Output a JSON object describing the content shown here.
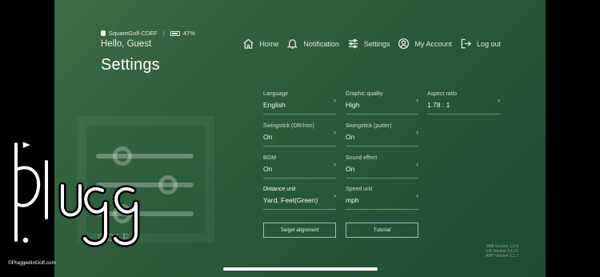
{
  "status": {
    "device": "SquareGolf-CDEF",
    "separator": "|",
    "battery": "47%"
  },
  "greeting": "Hello, Guest",
  "title": "Settings",
  "nav": [
    {
      "label": "Home",
      "icon": "home-icon"
    },
    {
      "label": "Notification",
      "icon": "bell-icon"
    },
    {
      "label": "Settings",
      "icon": "sliders-icon"
    },
    {
      "label": "My Account",
      "icon": "user-icon"
    },
    {
      "label": "Log out",
      "icon": "logout-icon"
    }
  ],
  "settings": {
    "language": {
      "label": "Language",
      "value": "English"
    },
    "graphic_quality": {
      "label": "Graphic quality",
      "value": "High"
    },
    "aspect_ratio": {
      "label": "Aspect ratio",
      "value": "1.78 : 1"
    },
    "swingstick_dr": {
      "label": "Swingstick (DR/Iron)",
      "value": "On"
    },
    "swingstick_putter": {
      "label": "Swingstick (putter)",
      "value": "On"
    },
    "bgm": {
      "label": "BGM",
      "value": "On"
    },
    "sound_effect": {
      "label": "Sound effect",
      "value": "On"
    },
    "distance_unit": {
      "label": "Distance unit",
      "value": "Yard,  Feet(Green)"
    },
    "speed_unit": {
      "label": "Speed unit",
      "value": "mph"
    }
  },
  "chevron": "›",
  "buttons": {
    "target_alignment": "Target alignment",
    "tutorial": "Tutorial"
  },
  "versions": [
    "RMI Version 1.0.6",
    "LM Version 1.6.15",
    "APP Version 1.1.7"
  ],
  "watermark": {
    "brand": "GOLF",
    "url": "©PluggedInGolf.com"
  }
}
